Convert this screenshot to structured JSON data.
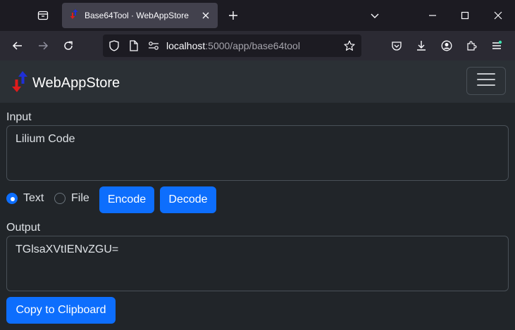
{
  "browser": {
    "tab": {
      "title": "Base64Tool · WebAppStore",
      "favicon": "webappstore-arrows-icon"
    },
    "url": {
      "host": "localhost",
      "path": ":5000/app/base64tool"
    },
    "icons": [
      "tab-list-icon",
      "close-icon",
      "plus-icon",
      "chevron-down-icon",
      "minimize-icon",
      "maximize-icon",
      "window-close-icon",
      "back-arrow-icon",
      "forward-arrow-icon",
      "reload-icon",
      "shield-icon",
      "page-icon",
      "permissions-icon",
      "star-icon",
      "pocket-icon",
      "download-icon",
      "account-icon",
      "extensions-icon",
      "menu-icon"
    ]
  },
  "app": {
    "brand": "WebAppStore",
    "input": {
      "label": "Input",
      "value": "Lilium Code"
    },
    "mode": {
      "text_label": "Text",
      "file_label": "File",
      "selected": "Text"
    },
    "buttons": {
      "encode": "Encode",
      "decode": "Decode",
      "copy": "Copy to Clipboard"
    },
    "output": {
      "label": "Output",
      "value": "TGlsaXVtIENvZGU="
    }
  },
  "colors": {
    "primary": "#0d6efd",
    "background": "#212529",
    "navbar": "#2b3035",
    "brand_up_arrow": "#1f2fd6",
    "brand_down_arrow": "#e01b1b"
  }
}
